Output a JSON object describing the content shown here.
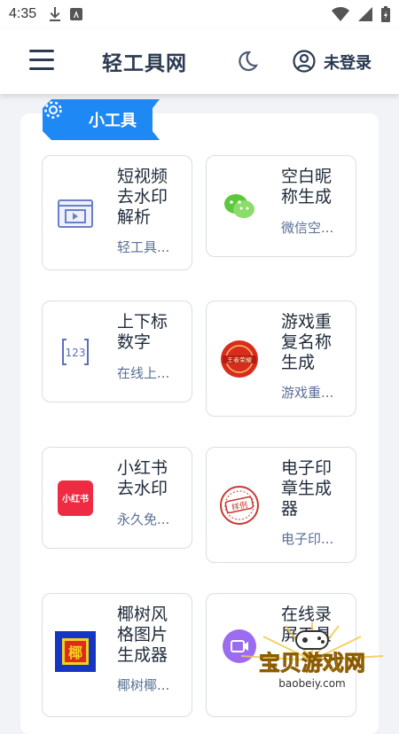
{
  "status_bar": {
    "time": "4:35"
  },
  "header": {
    "title": "轻工具网",
    "login": "未登录"
  },
  "section": {
    "label": "小工具"
  },
  "cards": [
    {
      "name": "短视频去水印解析",
      "desc": "轻工具...",
      "icon": "video-player-icon"
    },
    {
      "name": "空白昵称生成",
      "desc": "微信空...",
      "icon": "wechat-icon"
    },
    {
      "name": "上下标数字",
      "desc": "在线上...",
      "icon": "digits-123-icon"
    },
    {
      "name": "游戏重复名称生成",
      "desc": "游戏重...",
      "icon": "game-glory-icon"
    },
    {
      "name": "小红书去水印",
      "desc": "永久免...",
      "icon": "xiaohongshu-icon"
    },
    {
      "name": "电子印章生成器",
      "desc": "电子印...",
      "icon": "seal-stamp-icon"
    },
    {
      "name": "椰树风格图片生成器",
      "desc": "椰树椰...",
      "icon": "coconut-style-icon"
    },
    {
      "name": "在线录屏工具",
      "desc": "",
      "icon": "screen-record-icon"
    }
  ],
  "icon_texts": {
    "xiaohongshu": "小红书",
    "seal": "样例",
    "coconut": "椰",
    "digits": "123",
    "game": "王者荣耀"
  },
  "watermark": {
    "title": "宝贝游戏网",
    "url": "baobeiy.com"
  },
  "colors": {
    "primary": "#2b3a52",
    "badge": "#1e88f5",
    "desc": "#5a6f95"
  }
}
